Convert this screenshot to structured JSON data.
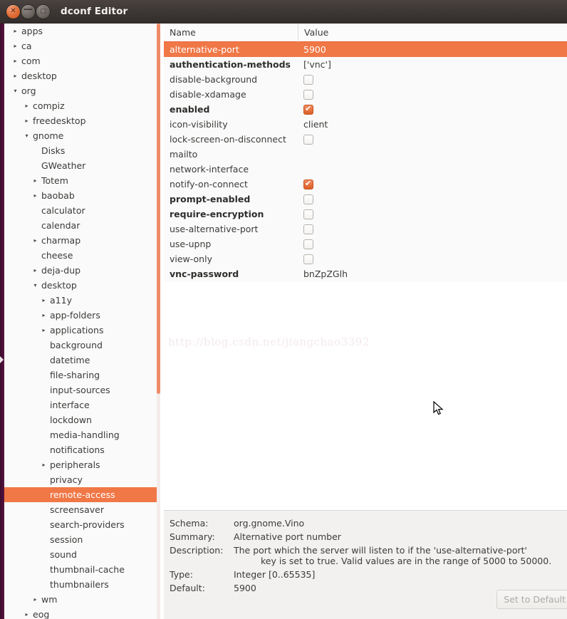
{
  "window": {
    "title": "dconf Editor",
    "buttons": {
      "close": "✕",
      "minimize": "—",
      "maximize": "□"
    }
  },
  "colors": {
    "selection": "#f07746",
    "titlebar": "#3c3735",
    "launcher": "#4b1038",
    "scrollbar": "#ef8b6a",
    "header_underline": "#e8683a"
  },
  "sidebar": {
    "items": [
      {
        "label": "apps",
        "depth": 0,
        "twisty": "collapsed",
        "selected": false
      },
      {
        "label": "ca",
        "depth": 0,
        "twisty": "collapsed",
        "selected": false
      },
      {
        "label": "com",
        "depth": 0,
        "twisty": "collapsed",
        "selected": false
      },
      {
        "label": "desktop",
        "depth": 0,
        "twisty": "collapsed",
        "selected": false
      },
      {
        "label": "org",
        "depth": 0,
        "twisty": "expanded",
        "selected": false
      },
      {
        "label": "compiz",
        "depth": 1,
        "twisty": "collapsed",
        "selected": false
      },
      {
        "label": "freedesktop",
        "depth": 1,
        "twisty": "collapsed",
        "selected": false
      },
      {
        "label": "gnome",
        "depth": 1,
        "twisty": "expanded",
        "selected": false
      },
      {
        "label": "Disks",
        "depth": 2,
        "twisty": "none",
        "selected": false
      },
      {
        "label": "GWeather",
        "depth": 2,
        "twisty": "none",
        "selected": false
      },
      {
        "label": "Totem",
        "depth": 2,
        "twisty": "collapsed",
        "selected": false
      },
      {
        "label": "baobab",
        "depth": 2,
        "twisty": "collapsed",
        "selected": false
      },
      {
        "label": "calculator",
        "depth": 2,
        "twisty": "none",
        "selected": false
      },
      {
        "label": "calendar",
        "depth": 2,
        "twisty": "none",
        "selected": false
      },
      {
        "label": "charmap",
        "depth": 2,
        "twisty": "collapsed",
        "selected": false
      },
      {
        "label": "cheese",
        "depth": 2,
        "twisty": "none",
        "selected": false
      },
      {
        "label": "deja-dup",
        "depth": 2,
        "twisty": "collapsed",
        "selected": false
      },
      {
        "label": "desktop",
        "depth": 2,
        "twisty": "expanded",
        "selected": false
      },
      {
        "label": "a11y",
        "depth": 3,
        "twisty": "collapsed",
        "selected": false
      },
      {
        "label": "app-folders",
        "depth": 3,
        "twisty": "collapsed",
        "selected": false
      },
      {
        "label": "applications",
        "depth": 3,
        "twisty": "collapsed",
        "selected": false
      },
      {
        "label": "background",
        "depth": 3,
        "twisty": "none",
        "selected": false
      },
      {
        "label": "datetime",
        "depth": 3,
        "twisty": "none",
        "selected": false
      },
      {
        "label": "file-sharing",
        "depth": 3,
        "twisty": "none",
        "selected": false
      },
      {
        "label": "input-sources",
        "depth": 3,
        "twisty": "none",
        "selected": false
      },
      {
        "label": "interface",
        "depth": 3,
        "twisty": "none",
        "selected": false
      },
      {
        "label": "lockdown",
        "depth": 3,
        "twisty": "none",
        "selected": false
      },
      {
        "label": "media-handling",
        "depth": 3,
        "twisty": "none",
        "selected": false
      },
      {
        "label": "notifications",
        "depth": 3,
        "twisty": "none",
        "selected": false
      },
      {
        "label": "peripherals",
        "depth": 3,
        "twisty": "collapsed",
        "selected": false
      },
      {
        "label": "privacy",
        "depth": 3,
        "twisty": "none",
        "selected": false
      },
      {
        "label": "remote-access",
        "depth": 3,
        "twisty": "none",
        "selected": true
      },
      {
        "label": "screensaver",
        "depth": 3,
        "twisty": "none",
        "selected": false
      },
      {
        "label": "search-providers",
        "depth": 3,
        "twisty": "none",
        "selected": false
      },
      {
        "label": "session",
        "depth": 3,
        "twisty": "none",
        "selected": false
      },
      {
        "label": "sound",
        "depth": 3,
        "twisty": "none",
        "selected": false
      },
      {
        "label": "thumbnail-cache",
        "depth": 3,
        "twisty": "none",
        "selected": false
      },
      {
        "label": "thumbnailers",
        "depth": 3,
        "twisty": "none",
        "selected": false
      },
      {
        "label": "wm",
        "depth": 2,
        "twisty": "collapsed",
        "selected": false
      },
      {
        "label": "eog",
        "depth": 1,
        "twisty": "collapsed",
        "selected": false
      }
    ]
  },
  "keylist": {
    "columns": {
      "name": "Name",
      "value": "Value"
    },
    "rows": [
      {
        "name": "alternative-port",
        "value": "5900",
        "type": "text",
        "modified": false,
        "selected": true
      },
      {
        "name": "authentication-methods",
        "value": "['vnc']",
        "type": "text",
        "modified": true,
        "selected": false
      },
      {
        "name": "disable-background",
        "value": "",
        "type": "checkbox",
        "checked": false,
        "modified": false,
        "selected": false
      },
      {
        "name": "disable-xdamage",
        "value": "",
        "type": "checkbox",
        "checked": false,
        "modified": false,
        "selected": false
      },
      {
        "name": "enabled",
        "value": "",
        "type": "checkbox",
        "checked": true,
        "modified": true,
        "selected": false
      },
      {
        "name": "icon-visibility",
        "value": "client",
        "type": "text",
        "modified": false,
        "selected": false
      },
      {
        "name": "lock-screen-on-disconnect",
        "value": "",
        "type": "checkbox",
        "checked": false,
        "modified": false,
        "selected": false
      },
      {
        "name": "mailto",
        "value": "",
        "type": "text",
        "modified": false,
        "selected": false
      },
      {
        "name": "network-interface",
        "value": "",
        "type": "text",
        "modified": false,
        "selected": false
      },
      {
        "name": "notify-on-connect",
        "value": "",
        "type": "checkbox",
        "checked": true,
        "modified": false,
        "selected": false
      },
      {
        "name": "prompt-enabled",
        "value": "",
        "type": "checkbox",
        "checked": false,
        "modified": true,
        "selected": false
      },
      {
        "name": "require-encryption",
        "value": "",
        "type": "checkbox",
        "checked": false,
        "modified": true,
        "selected": false
      },
      {
        "name": "use-alternative-port",
        "value": "",
        "type": "checkbox",
        "checked": false,
        "modified": false,
        "selected": false
      },
      {
        "name": "use-upnp",
        "value": "",
        "type": "checkbox",
        "checked": false,
        "modified": false,
        "selected": false
      },
      {
        "name": "view-only",
        "value": "",
        "type": "checkbox",
        "checked": false,
        "modified": false,
        "selected": false
      },
      {
        "name": "vnc-password",
        "value": "bnZpZGlh",
        "type": "text",
        "modified": true,
        "selected": false
      }
    ]
  },
  "watermark": "http://blog.csdn.net/jiangchao3392",
  "detail": {
    "schema_label": "Schema:",
    "schema_value": "org.gnome.Vino",
    "summary_label": "Summary:",
    "summary_value": "Alternative port number",
    "description_label": "Description:",
    "description_line1": "The port which the server will listen to if the 'use-alternative-port'",
    "description_line2": "key is set to true. Valid values are in the range of 5000 to 50000.",
    "type_label": "Type:",
    "type_value": "Integer [0..65535]",
    "default_label": "Default:",
    "default_value": "5900",
    "set_default_button": "Set to Default"
  }
}
